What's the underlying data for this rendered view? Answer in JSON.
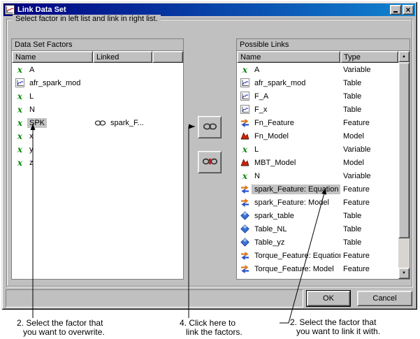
{
  "window": {
    "title": "Link Data Set",
    "title_icon": "graph-app-icon",
    "controls": [
      "minimize-icon",
      "close-icon"
    ]
  },
  "instruction": "Select factor in left list and link in right list.",
  "left_panel": {
    "title": "Data Set Factors",
    "columns": {
      "name": "Name",
      "linked": "Linked"
    },
    "rows": [
      {
        "icon": "variable-icon",
        "name": "A",
        "linked": ""
      },
      {
        "icon": "graph-icon",
        "name": "afr_spark_mod",
        "linked": ""
      },
      {
        "icon": "variable-icon",
        "name": "L",
        "linked": ""
      },
      {
        "icon": "variable-icon",
        "name": "N",
        "linked": ""
      },
      {
        "icon": "variable-icon",
        "name": "SPK",
        "linked": "spark_F...",
        "linked_icon": "chain-link-icon",
        "selected": true
      },
      {
        "icon": "variable-icon",
        "name": "x",
        "linked": ""
      },
      {
        "icon": "variable-icon",
        "name": "y",
        "linked": ""
      },
      {
        "icon": "variable-icon",
        "name": "z",
        "linked": ""
      }
    ]
  },
  "right_panel": {
    "title": "Possible Links",
    "columns": {
      "name": "Name",
      "type": "Type"
    },
    "rows": [
      {
        "icon": "variable-icon",
        "name": "A",
        "type": "Variable"
      },
      {
        "icon": "graph-icon",
        "name": "afr_spark_mod",
        "type": "Table"
      },
      {
        "icon": "graph-icon",
        "name": "F_A",
        "type": "Table"
      },
      {
        "icon": "graph-icon",
        "name": "F_x",
        "type": "Table"
      },
      {
        "icon": "feature-icon",
        "name": "Fn_Feature",
        "type": "Feature"
      },
      {
        "icon": "model-icon",
        "name": "Fn_Model",
        "type": "Model"
      },
      {
        "icon": "variable-icon",
        "name": "L",
        "type": "Variable"
      },
      {
        "icon": "model-icon",
        "name": "MBT_Model",
        "type": "Model"
      },
      {
        "icon": "variable-icon",
        "name": "N",
        "type": "Variable"
      },
      {
        "icon": "feature-icon",
        "name": "spark_Feature: Equation",
        "type": "Feature",
        "selected": true
      },
      {
        "icon": "feature-icon",
        "name": "spark_Feature: Model",
        "type": "Feature"
      },
      {
        "icon": "diamond-icon",
        "name": "spark_table",
        "type": "Table"
      },
      {
        "icon": "diamond-icon",
        "name": "Table_NL",
        "type": "Table"
      },
      {
        "icon": "diamond-icon",
        "name": "Table_yz",
        "type": "Table"
      },
      {
        "icon": "feature-icon",
        "name": "Torque_Feature: Equation",
        "type": "Feature"
      },
      {
        "icon": "feature-icon",
        "name": "Torque_Feature: Model",
        "type": "Feature"
      }
    ],
    "scrollbar": {
      "icons": [
        "scroll-up-icon",
        "scroll-down-icon"
      ]
    }
  },
  "middle_buttons": {
    "link": {
      "icon": "chain-link-icon"
    },
    "unlink": {
      "icon": "chain-unlink-icon"
    }
  },
  "footer": {
    "ok": "OK",
    "cancel": "Cancel"
  },
  "annotations": {
    "left": {
      "line1": "2. Select the factor that",
      "line2": "you want to overwrite."
    },
    "middle": {
      "line1": "4. Click here to",
      "line2": "link the factors."
    },
    "right": {
      "line1": "2. Select the factor that",
      "line2": "you want to link it with."
    }
  },
  "colors": {
    "dialog_bg": "#c0c0c0",
    "titlebar_start": "#000080",
    "titlebar_end": "#1084d0",
    "selection_bg": "#c4c4c4",
    "variable_icon": "#0a8a0a"
  }
}
